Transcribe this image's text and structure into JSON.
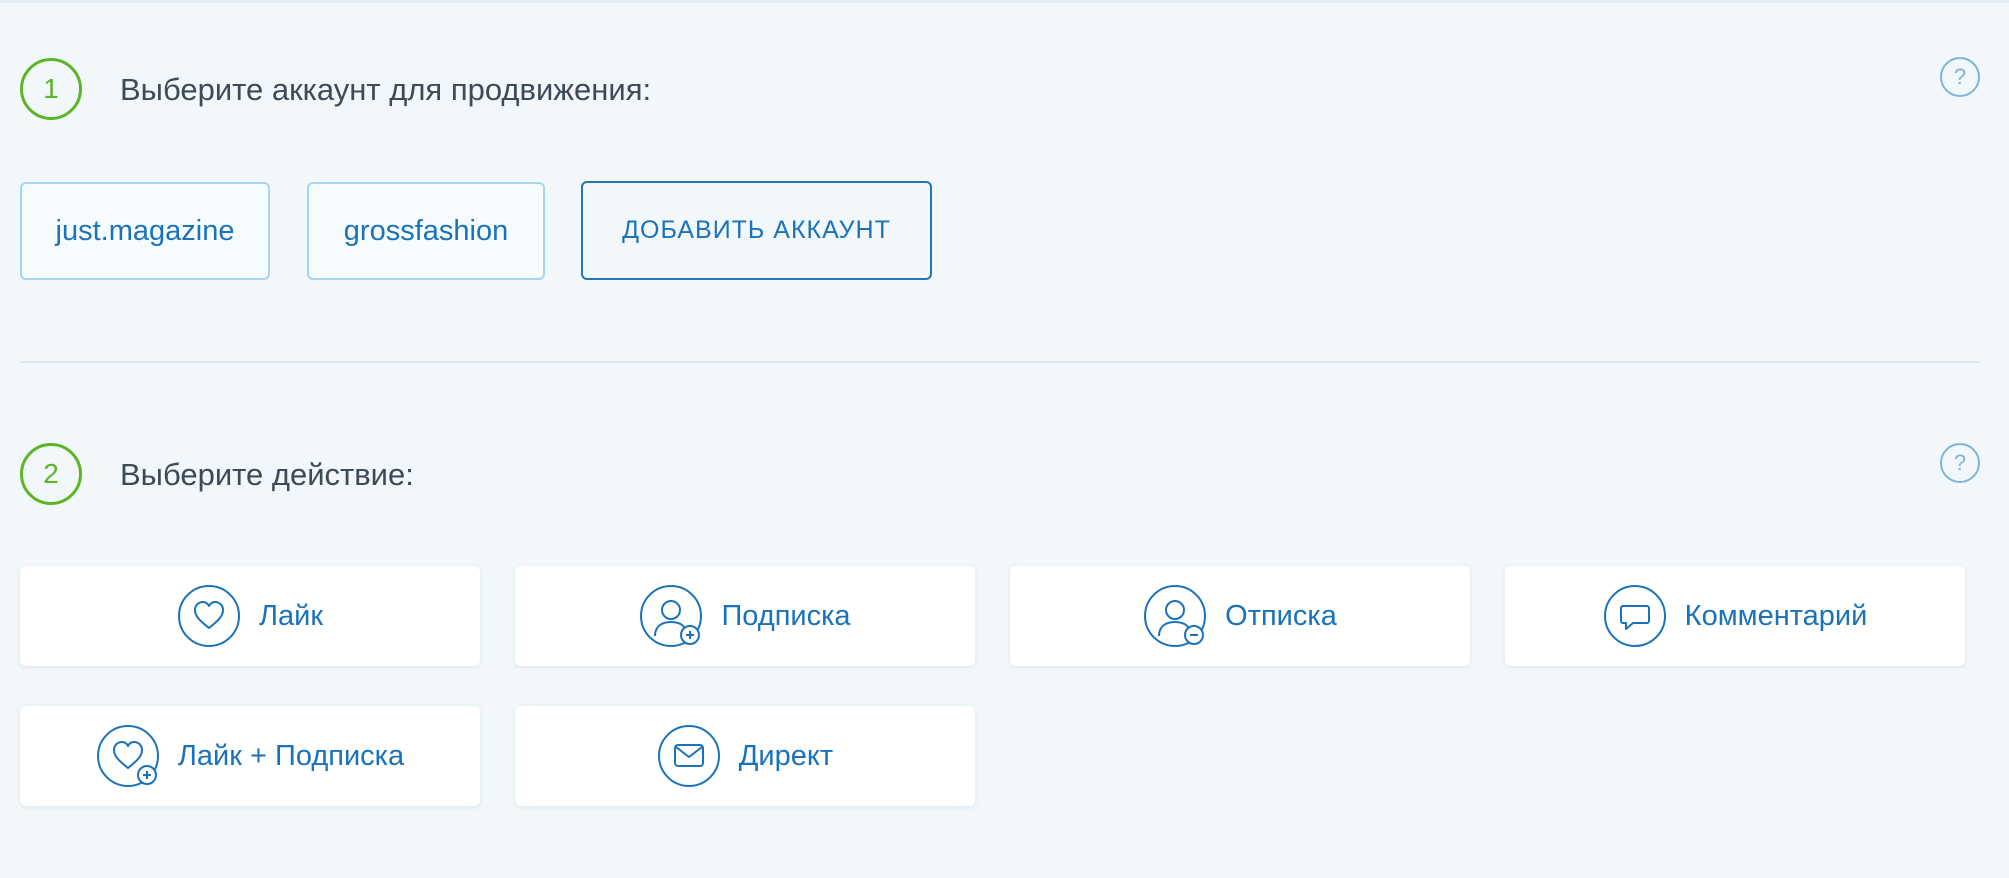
{
  "steps": [
    {
      "number": "1",
      "title": "Выберите аккаунт для продвижения:",
      "help": "?"
    },
    {
      "number": "2",
      "title": "Выберите действие:",
      "help": "?"
    }
  ],
  "accounts": [
    {
      "label": "just.magazine"
    },
    {
      "label": "grossfashion"
    }
  ],
  "add_account_label": "ДОБАВИТЬ АККАУНТ",
  "actions": [
    {
      "label": "Лайк",
      "icon": "heart-icon"
    },
    {
      "label": "Подписка",
      "icon": "user-plus-icon"
    },
    {
      "label": "Отписка",
      "icon": "user-minus-icon"
    },
    {
      "label": "Комментарий",
      "icon": "comment-icon"
    },
    {
      "label": "Лайк + Подписка",
      "icon": "heart-plus-icon"
    },
    {
      "label": "Директ",
      "icon": "mail-icon"
    }
  ],
  "colors": {
    "background": "#f1f7fa",
    "accent_green": "#5db526",
    "link_blue": "#1a72bb",
    "title_text": "#3d4a57",
    "help_icon": "#7fb4d8"
  }
}
